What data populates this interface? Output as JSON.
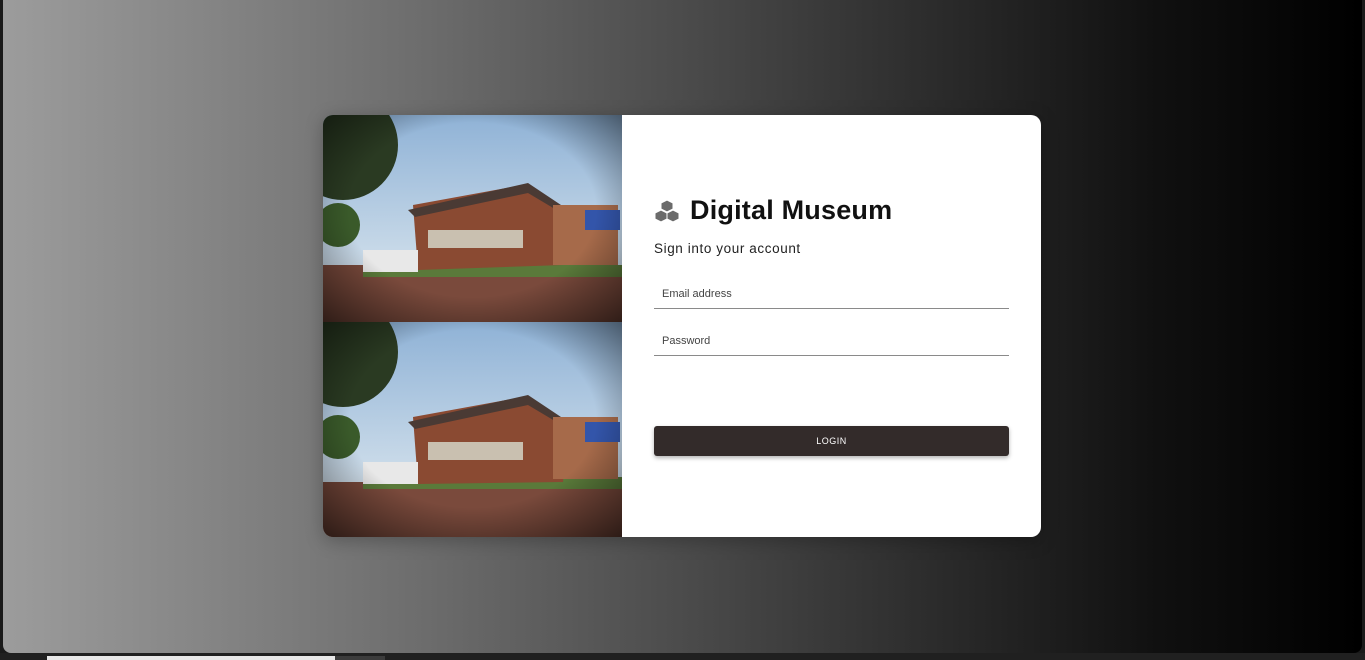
{
  "brand": {
    "title": "Digital Museum",
    "icon": "cubes-icon"
  },
  "form": {
    "subtitle": "Sign into your account",
    "email_placeholder": "Email address",
    "password_placeholder": "Password",
    "login_label": "LOGIN"
  },
  "colors": {
    "button": "#332b2a",
    "card": "#ffffff",
    "background_left": "#9c9c9c",
    "background_right": "#000000"
  }
}
